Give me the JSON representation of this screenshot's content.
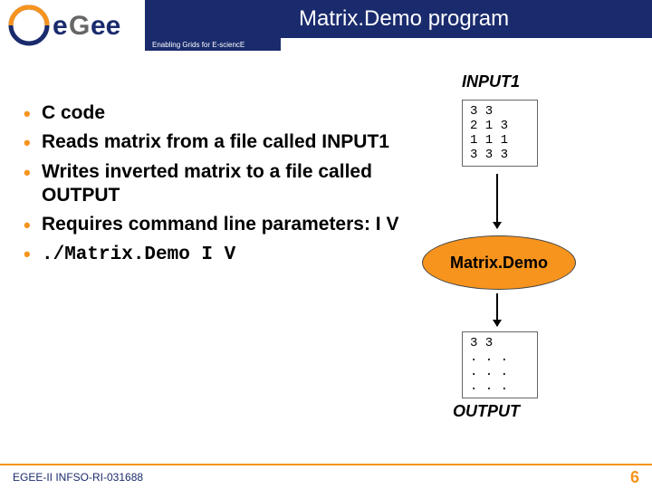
{
  "header": {
    "title": "Matrix.Demo program",
    "tagline": "Enabling Grids for E-sciencE",
    "logo_text_e": "e",
    "logo_text_rest": "Gee"
  },
  "labels": {
    "input": "INPUT1",
    "output": "OUTPUT",
    "oval": "Matrix.Demo"
  },
  "bullets": {
    "b1": "C code",
    "b2": "Reads matrix from a file called INPUT1",
    "b3": "Writes inverted matrix to a file called OUTPUT",
    "b4": "Requires command line parameters: I V",
    "b5": "./Matrix.Demo I V"
  },
  "box1": "3 3\n2 1 3\n1 1 1\n3 3 3",
  "box2": "3 3\n. . .\n. . .\n. . .",
  "footer": {
    "ref": "EGEE-II INFSO-RI-031688",
    "page": "6"
  }
}
